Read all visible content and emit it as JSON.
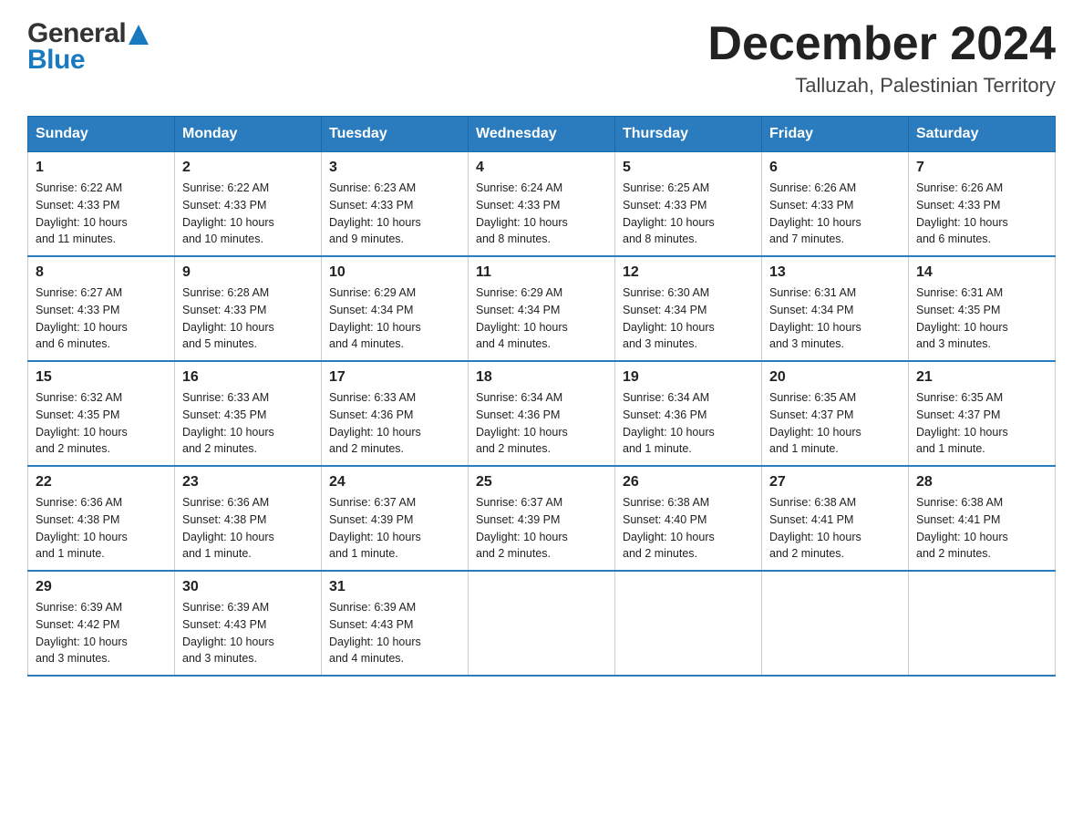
{
  "header": {
    "logo_general": "General",
    "logo_blue": "Blue",
    "month_title": "December 2024",
    "location": "Talluzah, Palestinian Territory"
  },
  "days_of_week": [
    "Sunday",
    "Monday",
    "Tuesday",
    "Wednesday",
    "Thursday",
    "Friday",
    "Saturday"
  ],
  "weeks": [
    [
      {
        "day": "1",
        "sunrise": "6:22 AM",
        "sunset": "4:33 PM",
        "daylight": "10 hours and 11 minutes."
      },
      {
        "day": "2",
        "sunrise": "6:22 AM",
        "sunset": "4:33 PM",
        "daylight": "10 hours and 10 minutes."
      },
      {
        "day": "3",
        "sunrise": "6:23 AM",
        "sunset": "4:33 PM",
        "daylight": "10 hours and 9 minutes."
      },
      {
        "day": "4",
        "sunrise": "6:24 AM",
        "sunset": "4:33 PM",
        "daylight": "10 hours and 8 minutes."
      },
      {
        "day": "5",
        "sunrise": "6:25 AM",
        "sunset": "4:33 PM",
        "daylight": "10 hours and 8 minutes."
      },
      {
        "day": "6",
        "sunrise": "6:26 AM",
        "sunset": "4:33 PM",
        "daylight": "10 hours and 7 minutes."
      },
      {
        "day": "7",
        "sunrise": "6:26 AM",
        "sunset": "4:33 PM",
        "daylight": "10 hours and 6 minutes."
      }
    ],
    [
      {
        "day": "8",
        "sunrise": "6:27 AM",
        "sunset": "4:33 PM",
        "daylight": "10 hours and 6 minutes."
      },
      {
        "day": "9",
        "sunrise": "6:28 AM",
        "sunset": "4:33 PM",
        "daylight": "10 hours and 5 minutes."
      },
      {
        "day": "10",
        "sunrise": "6:29 AM",
        "sunset": "4:34 PM",
        "daylight": "10 hours and 4 minutes."
      },
      {
        "day": "11",
        "sunrise": "6:29 AM",
        "sunset": "4:34 PM",
        "daylight": "10 hours and 4 minutes."
      },
      {
        "day": "12",
        "sunrise": "6:30 AM",
        "sunset": "4:34 PM",
        "daylight": "10 hours and 3 minutes."
      },
      {
        "day": "13",
        "sunrise": "6:31 AM",
        "sunset": "4:34 PM",
        "daylight": "10 hours and 3 minutes."
      },
      {
        "day": "14",
        "sunrise": "6:31 AM",
        "sunset": "4:35 PM",
        "daylight": "10 hours and 3 minutes."
      }
    ],
    [
      {
        "day": "15",
        "sunrise": "6:32 AM",
        "sunset": "4:35 PM",
        "daylight": "10 hours and 2 minutes."
      },
      {
        "day": "16",
        "sunrise": "6:33 AM",
        "sunset": "4:35 PM",
        "daylight": "10 hours and 2 minutes."
      },
      {
        "day": "17",
        "sunrise": "6:33 AM",
        "sunset": "4:36 PM",
        "daylight": "10 hours and 2 minutes."
      },
      {
        "day": "18",
        "sunrise": "6:34 AM",
        "sunset": "4:36 PM",
        "daylight": "10 hours and 2 minutes."
      },
      {
        "day": "19",
        "sunrise": "6:34 AM",
        "sunset": "4:36 PM",
        "daylight": "10 hours and 1 minute."
      },
      {
        "day": "20",
        "sunrise": "6:35 AM",
        "sunset": "4:37 PM",
        "daylight": "10 hours and 1 minute."
      },
      {
        "day": "21",
        "sunrise": "6:35 AM",
        "sunset": "4:37 PM",
        "daylight": "10 hours and 1 minute."
      }
    ],
    [
      {
        "day": "22",
        "sunrise": "6:36 AM",
        "sunset": "4:38 PM",
        "daylight": "10 hours and 1 minute."
      },
      {
        "day": "23",
        "sunrise": "6:36 AM",
        "sunset": "4:38 PM",
        "daylight": "10 hours and 1 minute."
      },
      {
        "day": "24",
        "sunrise": "6:37 AM",
        "sunset": "4:39 PM",
        "daylight": "10 hours and 1 minute."
      },
      {
        "day": "25",
        "sunrise": "6:37 AM",
        "sunset": "4:39 PM",
        "daylight": "10 hours and 2 minutes."
      },
      {
        "day": "26",
        "sunrise": "6:38 AM",
        "sunset": "4:40 PM",
        "daylight": "10 hours and 2 minutes."
      },
      {
        "day": "27",
        "sunrise": "6:38 AM",
        "sunset": "4:41 PM",
        "daylight": "10 hours and 2 minutes."
      },
      {
        "day": "28",
        "sunrise": "6:38 AM",
        "sunset": "4:41 PM",
        "daylight": "10 hours and 2 minutes."
      }
    ],
    [
      {
        "day": "29",
        "sunrise": "6:39 AM",
        "sunset": "4:42 PM",
        "daylight": "10 hours and 3 minutes."
      },
      {
        "day": "30",
        "sunrise": "6:39 AM",
        "sunset": "4:43 PM",
        "daylight": "10 hours and 3 minutes."
      },
      {
        "day": "31",
        "sunrise": "6:39 AM",
        "sunset": "4:43 PM",
        "daylight": "10 hours and 4 minutes."
      },
      null,
      null,
      null,
      null
    ]
  ],
  "labels": {
    "sunrise": "Sunrise: ",
    "sunset": "Sunset: ",
    "daylight": "Daylight: "
  }
}
